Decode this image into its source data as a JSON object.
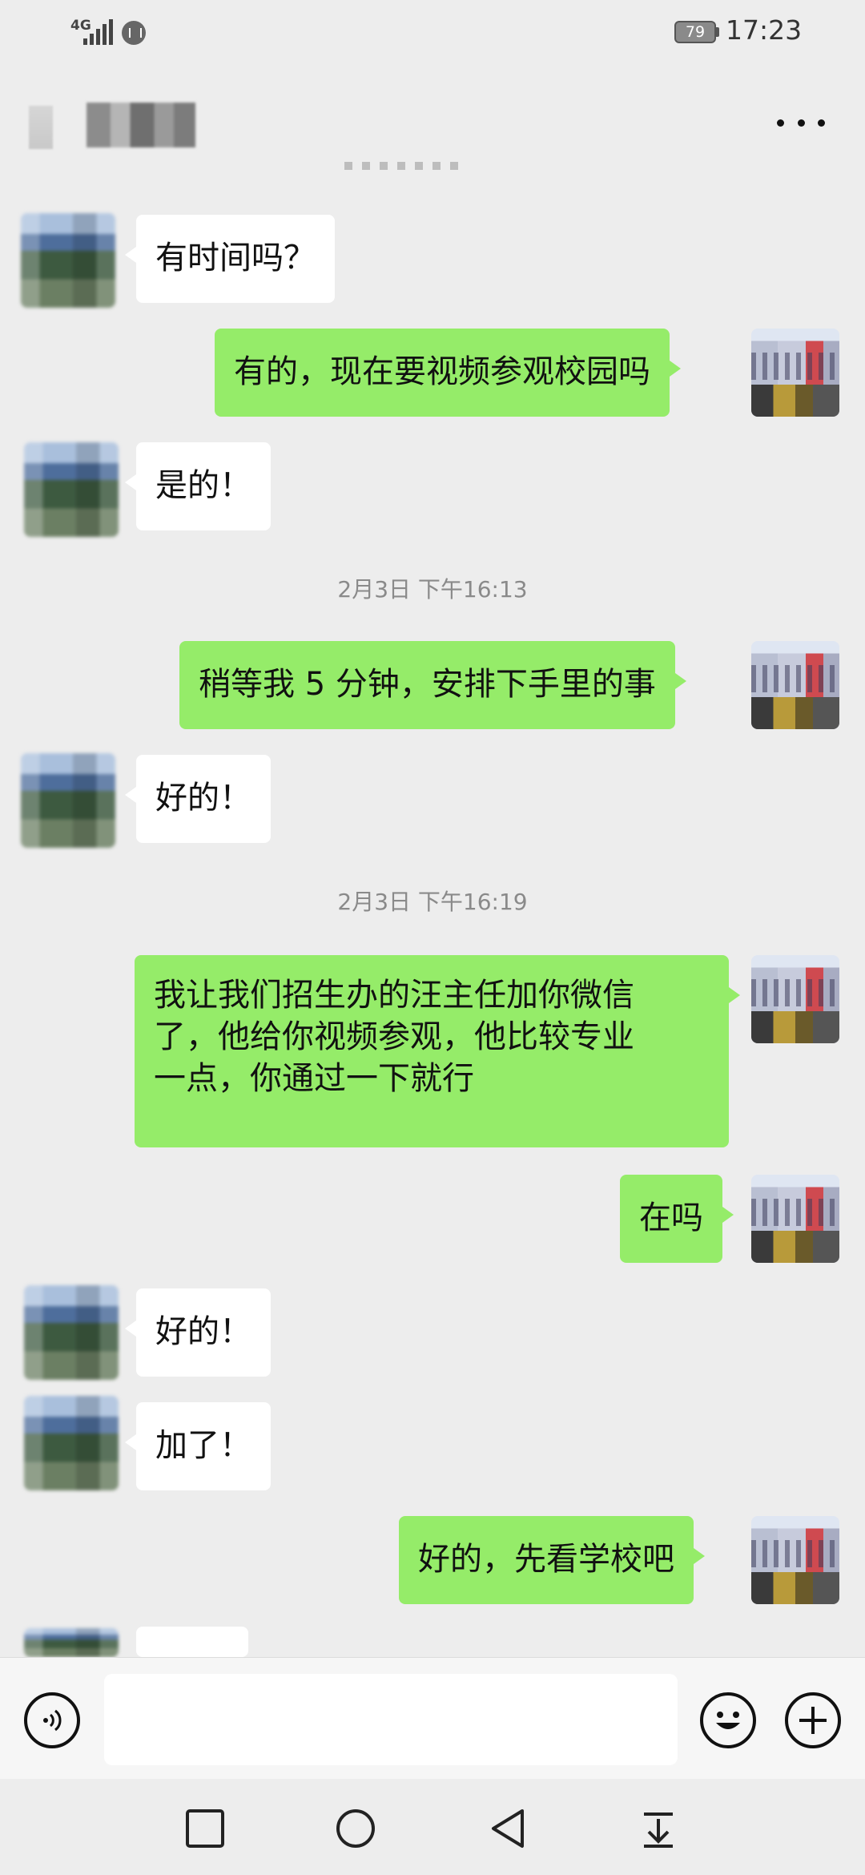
{
  "status_bar": {
    "network": "4G",
    "battery": "79",
    "time": "17:23"
  },
  "header": {
    "more_icon": "more-horizontal-icon"
  },
  "messages": [
    {
      "side": "in",
      "text": "有时间吗？"
    },
    {
      "side": "out",
      "text": "有的，现在要视频参观校园吗"
    },
    {
      "side": "in",
      "text": "是的！"
    },
    {
      "type": "timestamp",
      "text": "2月3日 下午16:13"
    },
    {
      "side": "out",
      "text": "稍等我 5 分钟，安排下手里的事"
    },
    {
      "side": "in",
      "text": "好的！"
    },
    {
      "type": "timestamp",
      "text": "2月3日 下午16:19"
    },
    {
      "side": "out",
      "text": "我让我们招生办的汪主任加你微信\n了，他给你视频参观，他比较专业\n一点，你通过一下就行"
    },
    {
      "side": "out",
      "text": "在吗"
    },
    {
      "side": "in",
      "text": "好的！"
    },
    {
      "side": "in",
      "text": "加了！"
    },
    {
      "side": "out",
      "text": "好的，先看学校吧"
    }
  ],
  "input_bar": {
    "voice_icon": "voice-input-icon",
    "emoji_icon": "emoji-icon",
    "plus_icon": "plus-icon",
    "placeholder": ""
  },
  "nav_bar": {
    "icons": [
      "recent-apps-icon",
      "home-icon",
      "back-icon",
      "notification-pull-icon"
    ]
  }
}
